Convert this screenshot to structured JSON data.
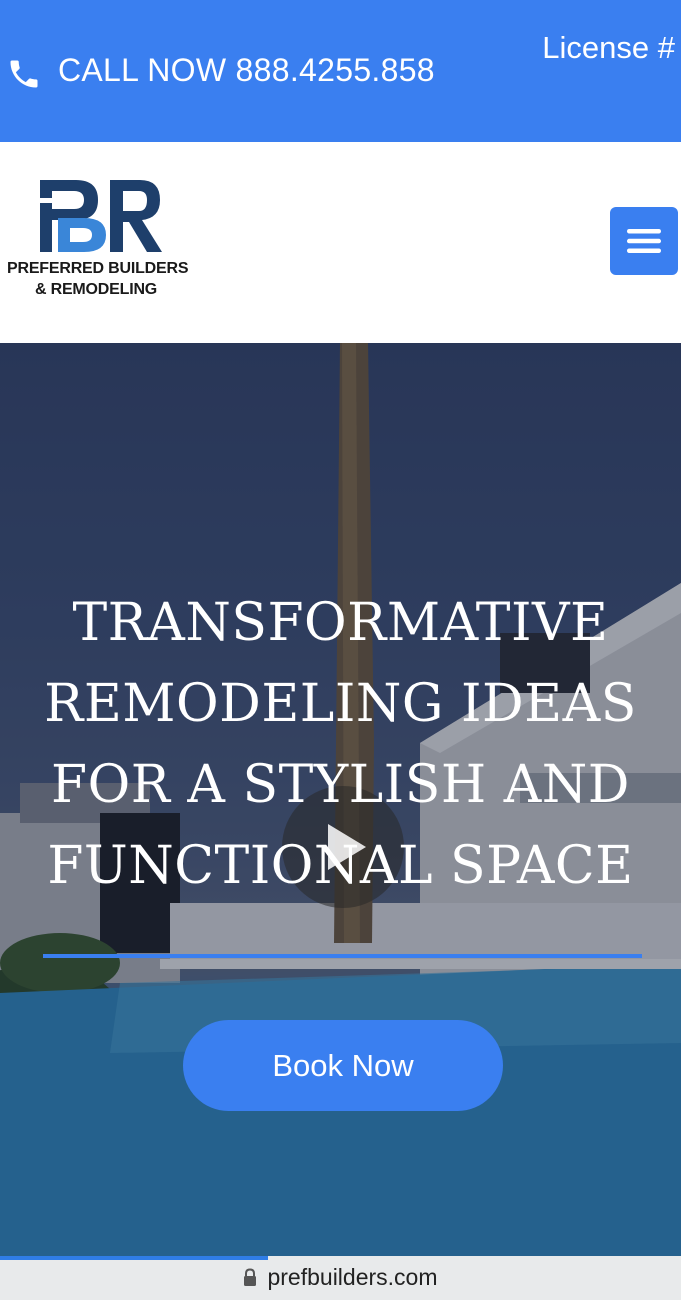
{
  "topbar": {
    "call_text": "CALL NOW 888.4255.858",
    "license_text": "License #",
    "phone_icon": "phone-icon",
    "background": "#3a7ff0"
  },
  "header": {
    "logo": {
      "monogram": "PBR",
      "line1": "PREFERRED BUILDERS",
      "line2": "& REMODELING"
    },
    "menu_icon": "hamburger-icon"
  },
  "hero": {
    "headline_lines": [
      "TRANSFORMATIVE",
      "REMODELING IDEAS",
      "FOR A STYLISH AND",
      "FUNCTIONAL SPACE"
    ],
    "button_label": "Book Now",
    "play_icon": "play-icon",
    "accent": "#3a7ff0"
  },
  "browser": {
    "url": "prefbuilders.com",
    "lock_icon": "lock-icon"
  }
}
